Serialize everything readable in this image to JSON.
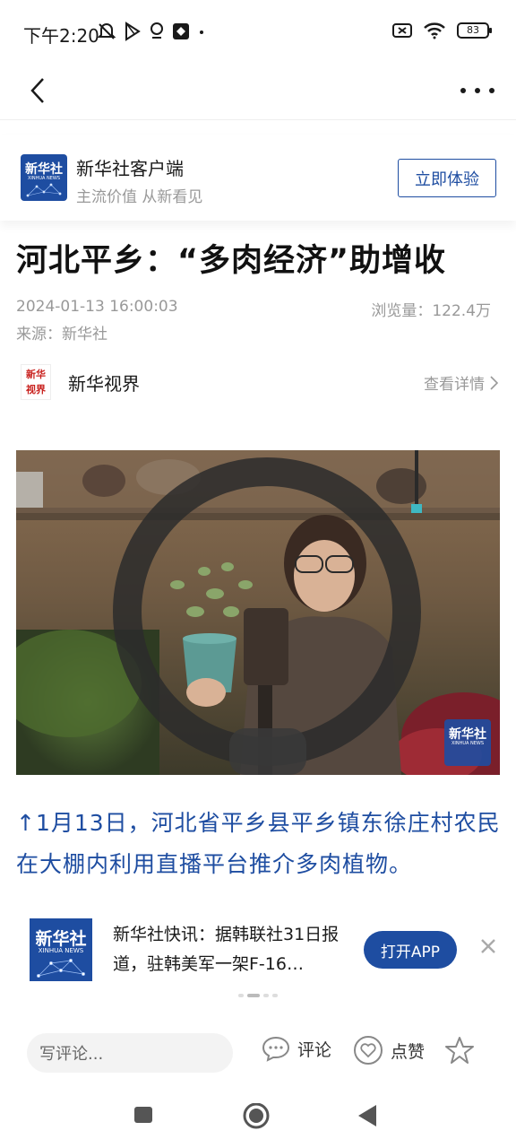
{
  "status_bar": {
    "time": "下午2:20",
    "battery": "83"
  },
  "app_banner": {
    "logo_cn": "新华社",
    "logo_en": "XINHUA NEWS",
    "name": "新华社客户端",
    "slogan": "主流价值 从新看见",
    "cta": "立即体验"
  },
  "article": {
    "title": "河北平乡：“多肉经济”助增收",
    "date": "2024-01-13 16:00:03",
    "views": "浏览量：122.4万",
    "source": "来源：新华社"
  },
  "channel": {
    "logo_text": "新华视界",
    "name": "新华视界",
    "detail": "查看详情"
  },
  "photo": {
    "watermark_cn": "新华社",
    "watermark_en": "XINHUA NEWS"
  },
  "caption": "↑1月13日，河北省平乡县平乡镇东徐庄村农民在大棚内利用直播平台推介多肉植物。",
  "news_card": {
    "logo_cn": "新华社",
    "logo_en": "XINHUA NEWS",
    "text": "新华社快讯：据韩联社31日报道，驻韩美军一架F-16…",
    "cta": "打开APP"
  },
  "bottom_bar": {
    "comment_placeholder": "写评论...",
    "comment_label": "评论",
    "like_label": "点赞"
  },
  "colors": {
    "accent": "#1e4da1",
    "muted": "#999999"
  }
}
